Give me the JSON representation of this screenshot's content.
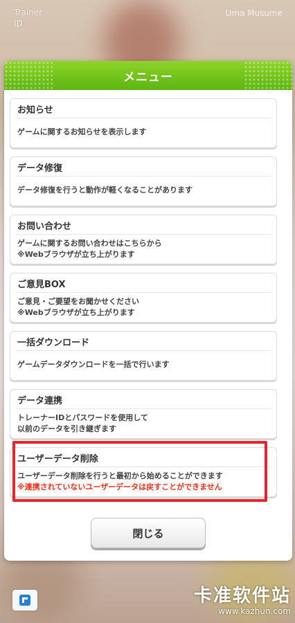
{
  "background": {
    "top_left_line1": "Trainer",
    "top_left_line2": "ID",
    "top_right": "Uma Musume"
  },
  "menu": {
    "title": "メニュー",
    "items": [
      {
        "title": "お知らせ",
        "lines": [
          "ゲームに関するお知らせを表示します"
        ]
      },
      {
        "title": "データ修復",
        "lines": [
          "データ修復を行うと動作が軽くなることがあります"
        ]
      },
      {
        "title": "お問い合わせ",
        "lines": [
          "ゲームに関するお問い合わせはこちらから",
          "※Webブラウザが立ち上がります"
        ]
      },
      {
        "title": "ご意見BOX",
        "lines": [
          "ご意見・ご要望をお聞かせください",
          "※Webブラウザが立ち上がります"
        ]
      },
      {
        "title": "一括ダウンロード",
        "lines": [
          "ゲームデータダウンロードを一括で行います"
        ]
      },
      {
        "title": "データ連携",
        "lines": [
          "トレーナーIDとパスワードを使用して",
          "以前のデータを引き継ぎます"
        ]
      },
      {
        "title": "ユーザーデータ削除",
        "lines": [
          "ユーザーデータ削除を行うと最初から始めることができます"
        ],
        "warning": "※連携されていないユーザーデータは戻すことができません"
      }
    ],
    "close_label": "閉じる"
  },
  "watermark": {
    "main": "卡准软件站",
    "sub": "www.kazhun.com"
  },
  "colors": {
    "header_green": "#72c31a",
    "warning_red": "#e8321b",
    "highlight_red": "#e5252b"
  }
}
